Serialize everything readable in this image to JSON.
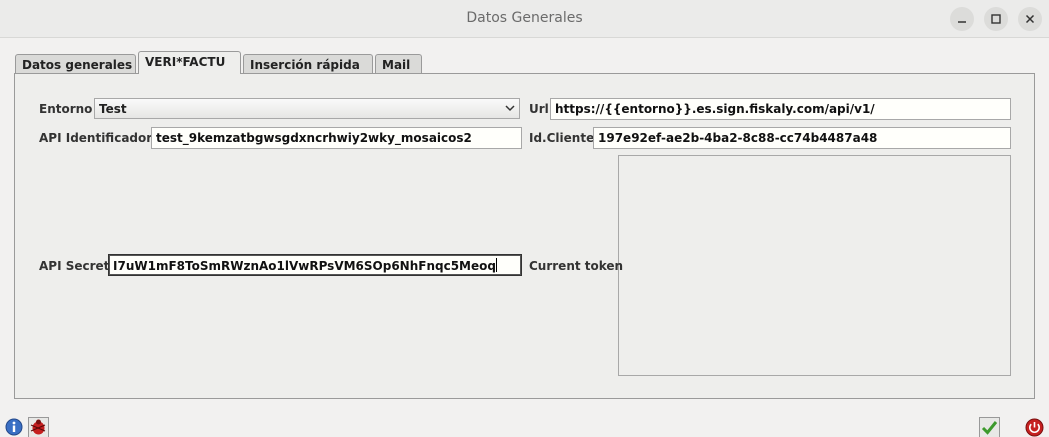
{
  "window": {
    "title": "Datos Generales"
  },
  "tabs": [
    {
      "label": "Datos generales"
    },
    {
      "label": "VERI*FACTU"
    },
    {
      "label": "Inserción rápida"
    },
    {
      "label": "Mail"
    }
  ],
  "form": {
    "entorno": {
      "label": "Entorno",
      "value": "Test"
    },
    "url": {
      "label": "Url",
      "value": "https://{{entorno}}.es.sign.fiskaly.com/api/v1/"
    },
    "api_id": {
      "label": "API Identificador",
      "value": "test_9kemzatbgwsgdxncrhwiy2wky_mosaicos2"
    },
    "id_cliente": {
      "label": "Id.Cliente",
      "value": "197e92ef-ae2b-4ba2-8c88-cc74b4487a48"
    },
    "api_secret": {
      "label": "API Secret",
      "value": "I7uW1mF8ToSmRWznAo1lVwRPsVM6SOp6NhFnqc5Meoq"
    },
    "current_token": {
      "label": "Current token",
      "value": ""
    }
  },
  "colors": {
    "accept_green": "#3d9a2d",
    "cancel_red": "#c62020",
    "info_blue": "#3a6fc4"
  }
}
